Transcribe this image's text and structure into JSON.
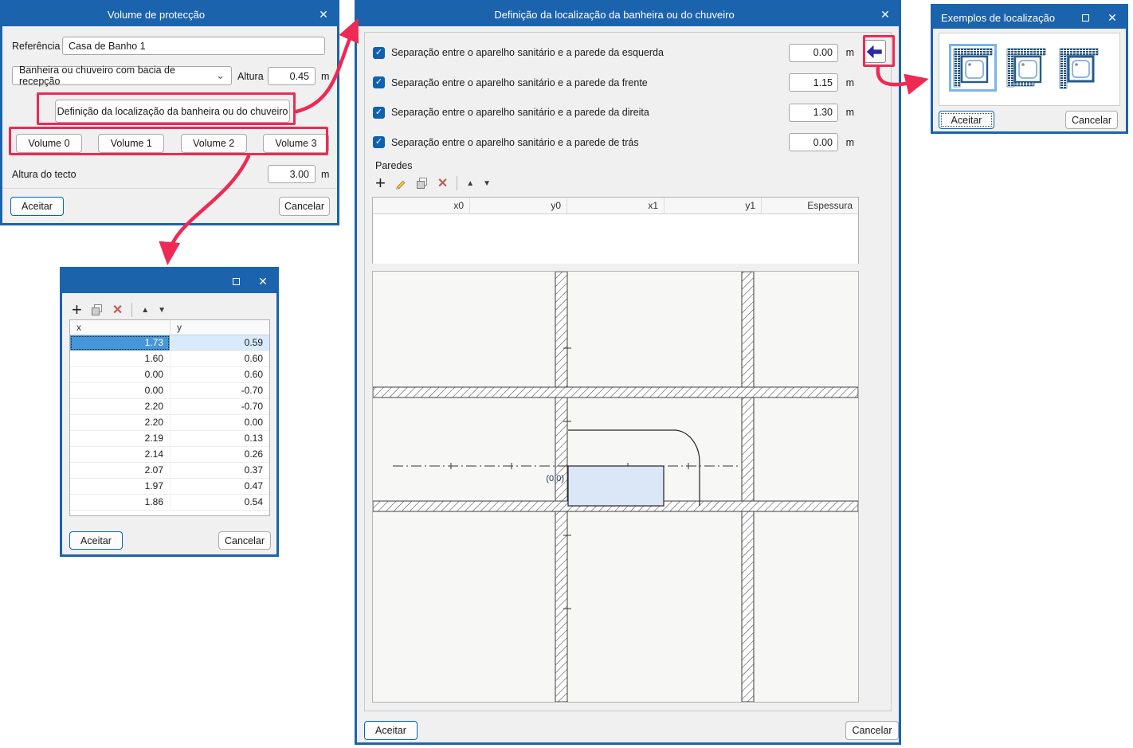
{
  "colors": {
    "titlebar_blue": "#1b63ad",
    "annotation_red": "#ee2a54",
    "dialog_bg": "#f0f0f0",
    "accent_button_border": "#0067c0",
    "selection_blue": "#4697da",
    "selection_light_blue": "#d8eafc",
    "tub_fill": "#dbe7f6",
    "checkbox_blue": "#0f62ad",
    "example_wall_blue": "#1f4e7a",
    "back_arrow_blue": "#2a2aae"
  },
  "icons": {
    "close": "✕",
    "add": "+",
    "delete": "✕",
    "up": "▲",
    "down": "▼",
    "chevron_down": "⌄",
    "check": "✓"
  },
  "volume_dialog": {
    "title": "Volume de protecção",
    "referencia_label": "Referência",
    "referencia_value": "Casa de Banho 1",
    "type_value": "Banheira ou chuveiro com bacia de recepção",
    "altura_label": "Altura",
    "altura_value": "0.45",
    "unit_m": "m",
    "definition_button": "Definição da localização da banheira ou do chuveiro",
    "volume_buttons": [
      "Volume 0",
      "Volume 1",
      "Volume 2",
      "Volume 3"
    ],
    "ceiling_label": "Altura do tecto",
    "ceiling_value": "3.00",
    "accept": "Aceitar",
    "cancel": "Cancelar"
  },
  "coords_dialog": {
    "columns": [
      "x",
      "y"
    ],
    "rows": [
      [
        "1.73",
        "0.59"
      ],
      [
        "1.60",
        "0.60"
      ],
      [
        "0.00",
        "0.60"
      ],
      [
        "0.00",
        "-0.70"
      ],
      [
        "2.20",
        "-0.70"
      ],
      [
        "2.20",
        "0.00"
      ],
      [
        "2.19",
        "0.13"
      ],
      [
        "2.14",
        "0.26"
      ],
      [
        "2.07",
        "0.37"
      ],
      [
        "1.97",
        "0.47"
      ],
      [
        "1.86",
        "0.54"
      ]
    ],
    "selected_row": 0,
    "accept": "Aceitar",
    "cancel": "Cancelar"
  },
  "location_dialog": {
    "title": "Definição da localização da banheira ou do chuveiro",
    "separations": [
      {
        "label": "Separação entre o aparelho sanitário e a parede da esquerda",
        "value": "0.00",
        "unit": "m",
        "checked": true
      },
      {
        "label": "Separação entre o aparelho sanitário e a parede da frente",
        "value": "1.15",
        "unit": "m",
        "checked": true
      },
      {
        "label": "Separação entre o aparelho sanitário e a parede da direita",
        "value": "1.30",
        "unit": "m",
        "checked": true
      },
      {
        "label": "Separação entre o aparelho sanitário e a parede de trás",
        "value": "0.00",
        "unit": "m",
        "checked": true
      }
    ],
    "walls_label": "Paredes",
    "walls_columns": [
      "x0",
      "y0",
      "x1",
      "y1",
      "Espessura"
    ],
    "origin_label": "(0,0)",
    "accept": "Aceitar",
    "cancel": "Cancelar"
  },
  "examples_dialog": {
    "title": "Exemplos de localização",
    "accept": "Aceitar",
    "cancel": "Cancelar"
  }
}
